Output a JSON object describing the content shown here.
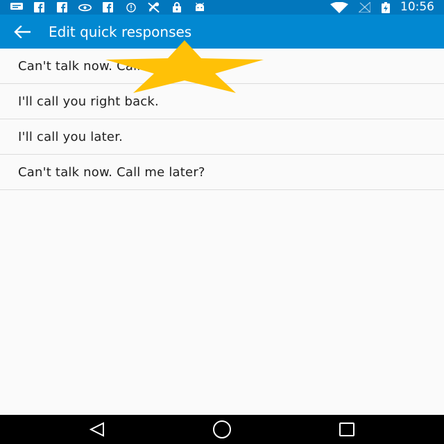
{
  "status_bar": {
    "time": "10:56",
    "left_icons": [
      "message-icon",
      "facebook-icon",
      "facebook-icon",
      "eye-icon",
      "facebook-icon",
      "info-icon",
      "no-location-icon",
      "lock-icon",
      "android-icon"
    ],
    "right_icons": [
      "wifi-icon",
      "no-signal-icon",
      "battery-charging-icon"
    ]
  },
  "toolbar": {
    "title": "Edit quick responses",
    "back_icon": "arrow-left-icon"
  },
  "responses": [
    "Can't talk now. Call me later?",
    "I'll call you right back.",
    "I'll call you later.",
    "Can't talk now. Call me later?"
  ],
  "overlay": {
    "icon": "star-icon",
    "color": "#ffc107"
  },
  "nav_bar": {
    "icons": [
      "back-triangle-icon",
      "home-circle-icon",
      "recents-square-icon"
    ]
  },
  "colors": {
    "status_bar": "#0277bd",
    "toolbar": "#0288d1",
    "background": "#fafafa"
  }
}
